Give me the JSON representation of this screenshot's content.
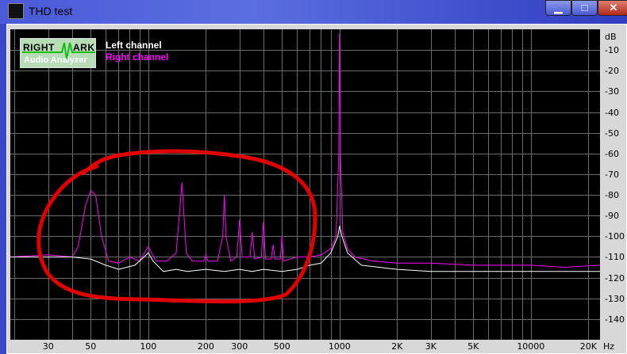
{
  "window": {
    "title": "THD test",
    "icon": "spectrum-icon",
    "buttons": [
      "minimize",
      "maximize",
      "close"
    ]
  },
  "logo": {
    "line1a": "RIGHT",
    "line1b": "ARK",
    "line2": "Audio Analyzer"
  },
  "legend": [
    {
      "label": "Left channel",
      "color": "#ffffff"
    },
    {
      "label": "Right channel",
      "color": "#ff00ff"
    }
  ],
  "chart_data": {
    "type": "line",
    "title": "THD test",
    "xlabel": "Hz",
    "ylabel": "dB",
    "xscale": "log",
    "xlim": [
      19,
      23000
    ],
    "ylim": [
      -150,
      0
    ],
    "x_ticks": [
      {
        "v": 30,
        "t": "30"
      },
      {
        "v": 50,
        "t": "50"
      },
      {
        "v": 100,
        "t": "100"
      },
      {
        "v": 200,
        "t": "200"
      },
      {
        "v": 300,
        "t": "300"
      },
      {
        "v": 500,
        "t": "500"
      },
      {
        "v": 1000,
        "t": "1000"
      },
      {
        "v": 2000,
        "t": "2K"
      },
      {
        "v": 3000,
        "t": "3K"
      },
      {
        "v": 5000,
        "t": "5K"
      },
      {
        "v": 10000,
        "t": "10000"
      },
      {
        "v": 20000,
        "t": "20K"
      }
    ],
    "y_ticks": [
      -10,
      -20,
      -30,
      -40,
      -50,
      -60,
      -70,
      -80,
      -90,
      -100,
      -110,
      -120,
      -130,
      -140
    ],
    "y_unit": "dB",
    "x_unit": "Hz",
    "grid": true,
    "legend": "top-left",
    "series": [
      {
        "name": "Right channel",
        "color": "#ff00ff",
        "points": [
          [
            19,
            -110
          ],
          [
            30,
            -109
          ],
          [
            40,
            -110
          ],
          [
            43,
            -105
          ],
          [
            47,
            -85
          ],
          [
            50,
            -78
          ],
          [
            53,
            -80
          ],
          [
            57,
            -100
          ],
          [
            62,
            -112
          ],
          [
            70,
            -113
          ],
          [
            80,
            -110
          ],
          [
            90,
            -112
          ],
          [
            97,
            -107
          ],
          [
            100,
            -105
          ],
          [
            104,
            -108
          ],
          [
            110,
            -112
          ],
          [
            125,
            -112
          ],
          [
            140,
            -108
          ],
          [
            150,
            -74
          ],
          [
            158,
            -108
          ],
          [
            170,
            -112
          ],
          [
            195,
            -112
          ],
          [
            200,
            -109
          ],
          [
            205,
            -112
          ],
          [
            230,
            -112
          ],
          [
            245,
            -100
          ],
          [
            250,
            -80
          ],
          [
            255,
            -100
          ],
          [
            270,
            -112
          ],
          [
            290,
            -110
          ],
          [
            300,
            -92
          ],
          [
            310,
            -110
          ],
          [
            340,
            -110
          ],
          [
            350,
            -98
          ],
          [
            360,
            -111
          ],
          [
            390,
            -110
          ],
          [
            400,
            -93
          ],
          [
            410,
            -111
          ],
          [
            440,
            -111
          ],
          [
            450,
            -104
          ],
          [
            460,
            -111
          ],
          [
            490,
            -111
          ],
          [
            500,
            -100
          ],
          [
            510,
            -112
          ],
          [
            550,
            -111
          ],
          [
            600,
            -110
          ],
          [
            700,
            -110
          ],
          [
            800,
            -109
          ],
          [
            900,
            -106
          ],
          [
            960,
            -100
          ],
          [
            990,
            -60
          ],
          [
            1000,
            -2
          ],
          [
            1010,
            -60
          ],
          [
            1040,
            -98
          ],
          [
            1100,
            -106
          ],
          [
            1200,
            -110
          ],
          [
            1500,
            -112
          ],
          [
            2000,
            -113
          ],
          [
            3000,
            -113
          ],
          [
            5000,
            -114
          ],
          [
            10000,
            -114
          ],
          [
            15000,
            -115
          ],
          [
            23000,
            -114
          ]
        ]
      },
      {
        "name": "Left channel",
        "color": "#ffffff",
        "points": [
          [
            19,
            -110
          ],
          [
            40,
            -110
          ],
          [
            50,
            -111
          ],
          [
            60,
            -114
          ],
          [
            70,
            -116
          ],
          [
            85,
            -114
          ],
          [
            95,
            -110
          ],
          [
            100,
            -108
          ],
          [
            106,
            -112
          ],
          [
            120,
            -117
          ],
          [
            140,
            -116
          ],
          [
            160,
            -117
          ],
          [
            200,
            -116
          ],
          [
            250,
            -117
          ],
          [
            300,
            -116
          ],
          [
            350,
            -117
          ],
          [
            400,
            -116
          ],
          [
            500,
            -117
          ],
          [
            600,
            -116
          ],
          [
            700,
            -114
          ],
          [
            800,
            -113
          ],
          [
            900,
            -108
          ],
          [
            980,
            -100
          ],
          [
            1000,
            -95
          ],
          [
            1030,
            -100
          ],
          [
            1100,
            -108
          ],
          [
            1300,
            -114
          ],
          [
            2000,
            -116
          ],
          [
            3000,
            -117
          ],
          [
            5000,
            -117
          ],
          [
            10000,
            -117
          ],
          [
            23000,
            -117
          ]
        ]
      }
    ]
  }
}
